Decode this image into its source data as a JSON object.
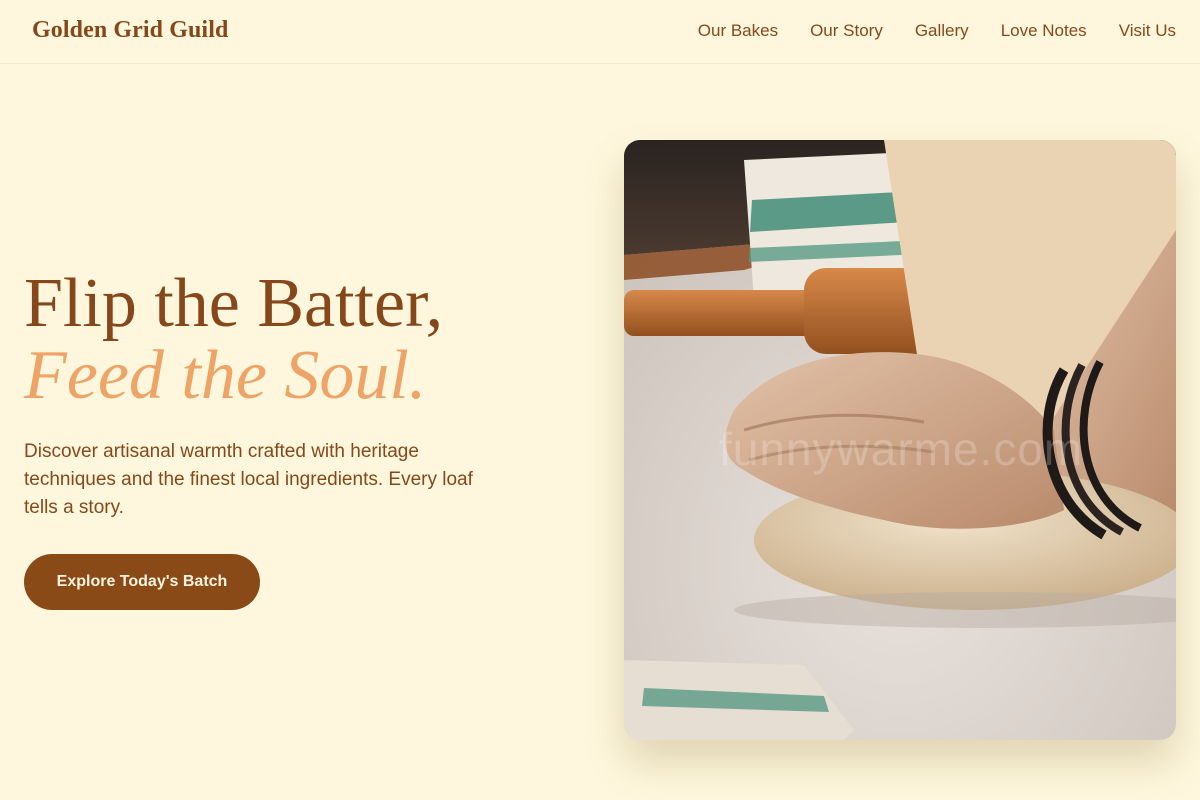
{
  "brand": "Golden Grid Guild",
  "nav": {
    "items": [
      "Our Bakes",
      "Our Story",
      "Gallery",
      "Love Notes",
      "Visit Us"
    ]
  },
  "hero": {
    "title_line1": "Flip the Batter,",
    "title_line2": "Feed the Soul.",
    "description": "Discover artisanal warmth crafted with heritage techniques and the finest local ingredients. Every loaf tells a story.",
    "cta_label": "Explore Today's Batch"
  },
  "image": {
    "alt": "Hands kneading dough on a floured surface",
    "watermark": "funnywarme.com"
  },
  "colors": {
    "background": "#FEF7DD",
    "brown": "#86481A",
    "accent": "#EDA466",
    "button": "#894A18"
  }
}
